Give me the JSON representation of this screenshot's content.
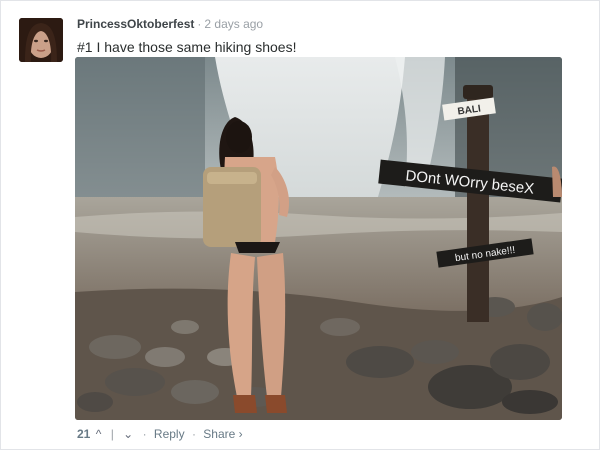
{
  "comment": {
    "username": "PrincessOktoberfest",
    "separator": "·",
    "timestamp": "2 days ago",
    "text": "#1 I have those same hiking shoes!",
    "image": {
      "sign_texts": [
        "BALI",
        "DOnt WOrry beseX",
        "but no nake!!!"
      ]
    },
    "footer": {
      "vote_count": "21",
      "upvote_icon": "^",
      "downvote_icon": "⌄",
      "reply_label": "Reply",
      "share_label": "Share ›",
      "dot": "·"
    }
  },
  "colors": {
    "username": "#3f4549",
    "muted": "#9aa0a6",
    "action": "#687a86",
    "text": "#2a2e2e"
  }
}
